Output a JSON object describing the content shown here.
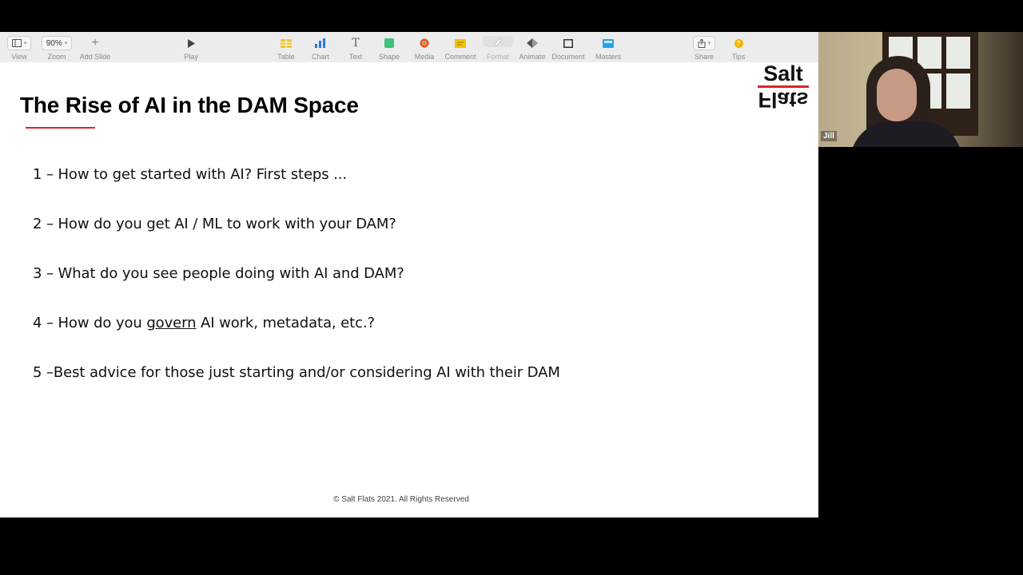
{
  "toolbar": {
    "zoom_value": "90%",
    "view_label": "View",
    "zoom_label": "Zoom",
    "add_slide_label": "Add Slide",
    "play_label": "Play",
    "table_label": "Table",
    "chart_label": "Chart",
    "text_label": "Text",
    "shape_label": "Shape",
    "media_label": "Media",
    "comment_label": "Comment",
    "format_label": "Format",
    "animate_label": "Animate",
    "document_label": "Document",
    "masters_label": "Masters",
    "share_label": "Share",
    "tips_label": "Tips",
    "text_icon_glyph": "T",
    "tips_icon_glyph": "?"
  },
  "slide": {
    "title": "The Rise of AI in the DAM Space",
    "logo_top": "Salt",
    "logo_bottom": "Flats",
    "items": [
      {
        "text": "1 – How to get started with AI? First steps ..."
      },
      {
        "text": "2 – How do you get AI / ML to work with your DAM?"
      },
      {
        "text": "3 – What do you see people doing with AI and DAM?"
      },
      {
        "pre": "4 – How do you ",
        "underlined": "govern",
        "post": " AI work, metadata, etc.?"
      },
      {
        "text": "5 –Best advice for those just starting and/or considering AI with their DAM"
      }
    ],
    "footer": "© Salt Flats 2021. All Rights Reserved"
  },
  "video": {
    "participant_name": "Jill"
  },
  "colors": {
    "accent_red": "#d9262e",
    "toolbar_bg": "#ececec",
    "table_icon": "#f4c430",
    "chart_icon": "#2b7bd6",
    "shape_icon": "#3ec27a",
    "comment_icon": "#f2c200",
    "masters_icon": "#29a3e0",
    "tips_icon": "#f5b400"
  }
}
